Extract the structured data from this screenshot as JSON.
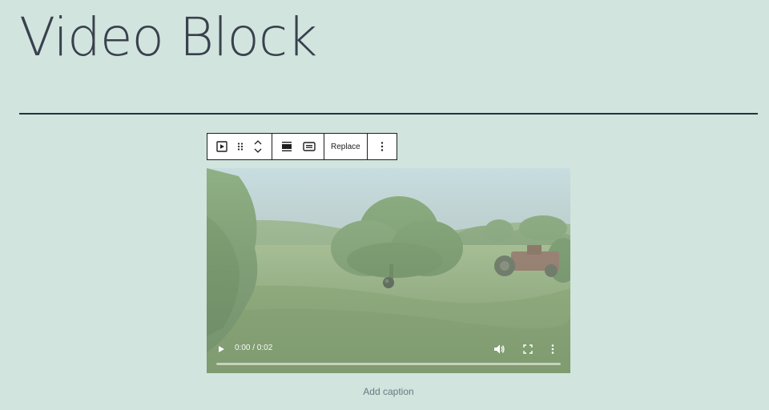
{
  "page": {
    "title": "Video Block",
    "background": "#d1e4dd"
  },
  "toolbar": {
    "block_type_icon": "video-icon",
    "drag_icon": "drag-handle-icon",
    "move_up_icon": "chevron-up-icon",
    "move_down_icon": "chevron-down-icon",
    "align_icon": "align-wide-icon",
    "caption_icon": "caption-icon",
    "replace_label": "Replace",
    "options_icon": "more-vertical-icon"
  },
  "video": {
    "time_label": "0:00 / 0:02",
    "progress": 0,
    "play_icon": "play-icon",
    "volume_icon": "volume-icon",
    "fullscreen_icon": "fullscreen-icon",
    "more_icon": "more-vertical-icon"
  },
  "caption": {
    "placeholder": "Add caption"
  }
}
